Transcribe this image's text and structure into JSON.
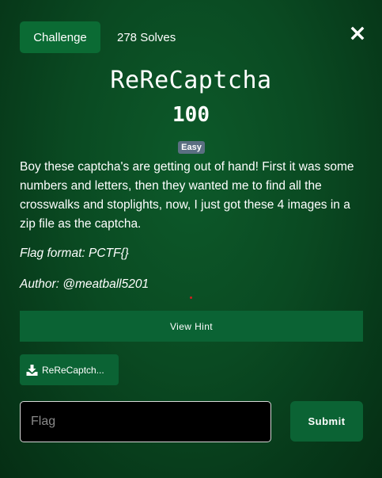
{
  "tabs": {
    "challenge_label": "Challenge",
    "solves_label": "278 Solves"
  },
  "close_icon": "close-icon",
  "challenge": {
    "name": "ReReCaptcha",
    "points": "100",
    "difficulty": "Easy",
    "description": "Boy these captcha's are getting out of hand! First it was some numbers and letters, then they wanted me to find all the crosswalks and stoplights, now, I just got these 4 images in a zip file as the captcha.",
    "flag_format": "Flag format: PCTF{}",
    "author": "Author: @meatball5201"
  },
  "hint": {
    "label": "View Hint"
  },
  "file": {
    "label": "ReReCaptch...",
    "icon": "download-icon"
  },
  "flag_input": {
    "placeholder": "Flag",
    "value": ""
  },
  "submit": {
    "label": "Submit"
  },
  "colors": {
    "background": "#0a4a22",
    "button": "#0b6334",
    "badge": "#5b6f82",
    "input_bg": "#000000"
  }
}
